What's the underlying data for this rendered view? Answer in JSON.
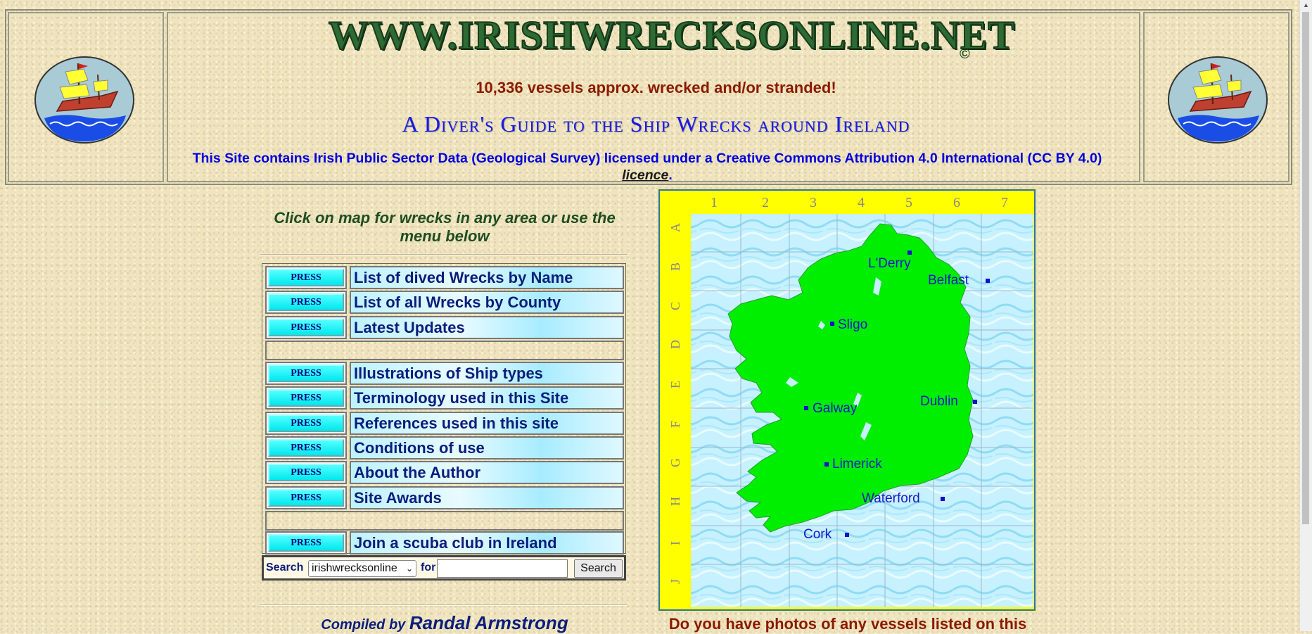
{
  "header": {
    "site_title": "WWW.IRISHWRECKSONLINE.NET",
    "copyright": "©",
    "vessel_count": "10,336 vessels approx. wrecked and/or stranded!",
    "subtitle": "A Diver's Guide to the Ship Wrecks around Ireland",
    "license_text": "This Site contains Irish Public Sector Data (Geological Survey) licensed under a Creative Commons Attribution 4.0 International (CC BY 4.0)",
    "license_link": "licence",
    "license_end": "."
  },
  "menu": {
    "intro": "Click on map for wrecks in any area or use the menu below",
    "press_label": "PRESS",
    "items": [
      {
        "label": "List of dived Wrecks by Name"
      },
      {
        "label": "List of all Wrecks by County"
      },
      {
        "label": "Latest Updates"
      },
      {
        "label": "Illustrations of Ship types"
      },
      {
        "label": "Terminology used in this Site"
      },
      {
        "label": "References used in this site"
      },
      {
        "label": "Conditions of use"
      },
      {
        "label": "About the Author"
      },
      {
        "label": "Site Awards"
      },
      {
        "label": "Join a scuba club in Ireland"
      }
    ]
  },
  "search": {
    "label": "Search",
    "selected": "irishwrecksonline",
    "for_label": "for",
    "value": "",
    "button": "Search"
  },
  "footer": {
    "compiled_prefix": "Compiled by",
    "author": "Randal Armstrong",
    "photos_prompt": "Do you have photos of any vessels listed on this"
  },
  "map": {
    "columns": [
      "1",
      "2",
      "3",
      "4",
      "5",
      "6",
      "7"
    ],
    "rows": [
      "A",
      "B",
      "C",
      "D",
      "E",
      "F",
      "G",
      "H",
      "I",
      "J"
    ],
    "cities": {
      "lderry": "L'Derry",
      "belfast": "Belfast",
      "sligo": "Sligo",
      "dublin": "Dublin",
      "galway": "Galway",
      "limerick": "Limerick",
      "waterford": "Waterford",
      "cork": "Cork"
    },
    "land_color": "#00ee00",
    "sea_color": "#bfefff",
    "frame_color": "#ffff00"
  }
}
